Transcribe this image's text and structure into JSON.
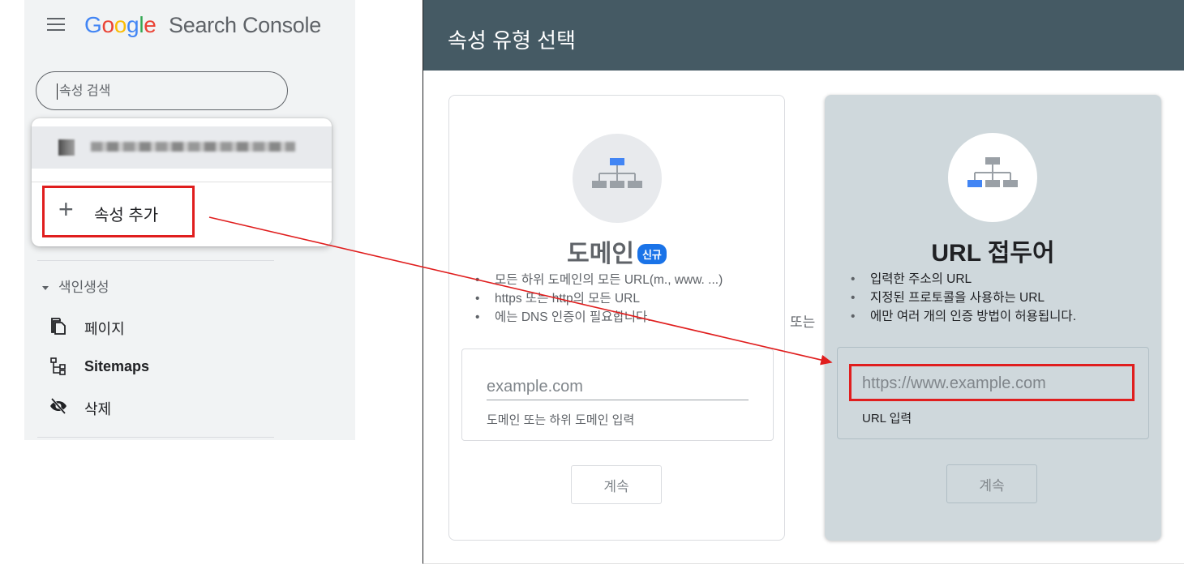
{
  "header": {
    "product_name": "Search Console",
    "google_letters": [
      {
        "ch": "G",
        "color": "#4285F4"
      },
      {
        "ch": "o",
        "color": "#EA4335"
      },
      {
        "ch": "o",
        "color": "#FBBC05"
      },
      {
        "ch": "g",
        "color": "#4285F4"
      },
      {
        "ch": "l",
        "color": "#34A853"
      },
      {
        "ch": "e",
        "color": "#EA4335"
      }
    ]
  },
  "search": {
    "placeholder": "속성 검색"
  },
  "dropdown": {
    "add_property_label": "속성 추가",
    "plus_symbol": "+"
  },
  "sidebar": {
    "section_title": "색인생성",
    "items": [
      {
        "label": "페이지",
        "icon": "pages-icon"
      },
      {
        "label": "Sitemaps",
        "icon": "sitemap-icon"
      },
      {
        "label": "삭제",
        "icon": "removals-icon"
      }
    ]
  },
  "modal": {
    "title": "속성 유형 선택",
    "or_label": "또는",
    "domain_card": {
      "title": "도메인",
      "badge": "신규",
      "bullets": [
        "모든 하위 도메인의 모든 URL(m., www. ...)",
        "https 또는 http의 모든 URL",
        "에는 DNS 인증이 필요합니다."
      ],
      "input_placeholder": "example.com",
      "input_hint": "도메인 또는 하위 도메인 입력",
      "continue_label": "계속"
    },
    "url_card": {
      "title": "URL 접두어",
      "bullets": [
        "입력한 주소의 URL",
        "지정된 프로토콜을 사용하는 URL",
        "에만 여러 개의 인증 방법이 허용됩니다."
      ],
      "input_placeholder": "https://www.example.com",
      "input_hint": "URL 입력",
      "continue_label": "계속"
    }
  },
  "colors": {
    "header_bg": "#455a64",
    "highlight_red": "#e01e1e",
    "badge_blue": "#1a73e8",
    "selected_card_bg": "#cfd8dc"
  }
}
